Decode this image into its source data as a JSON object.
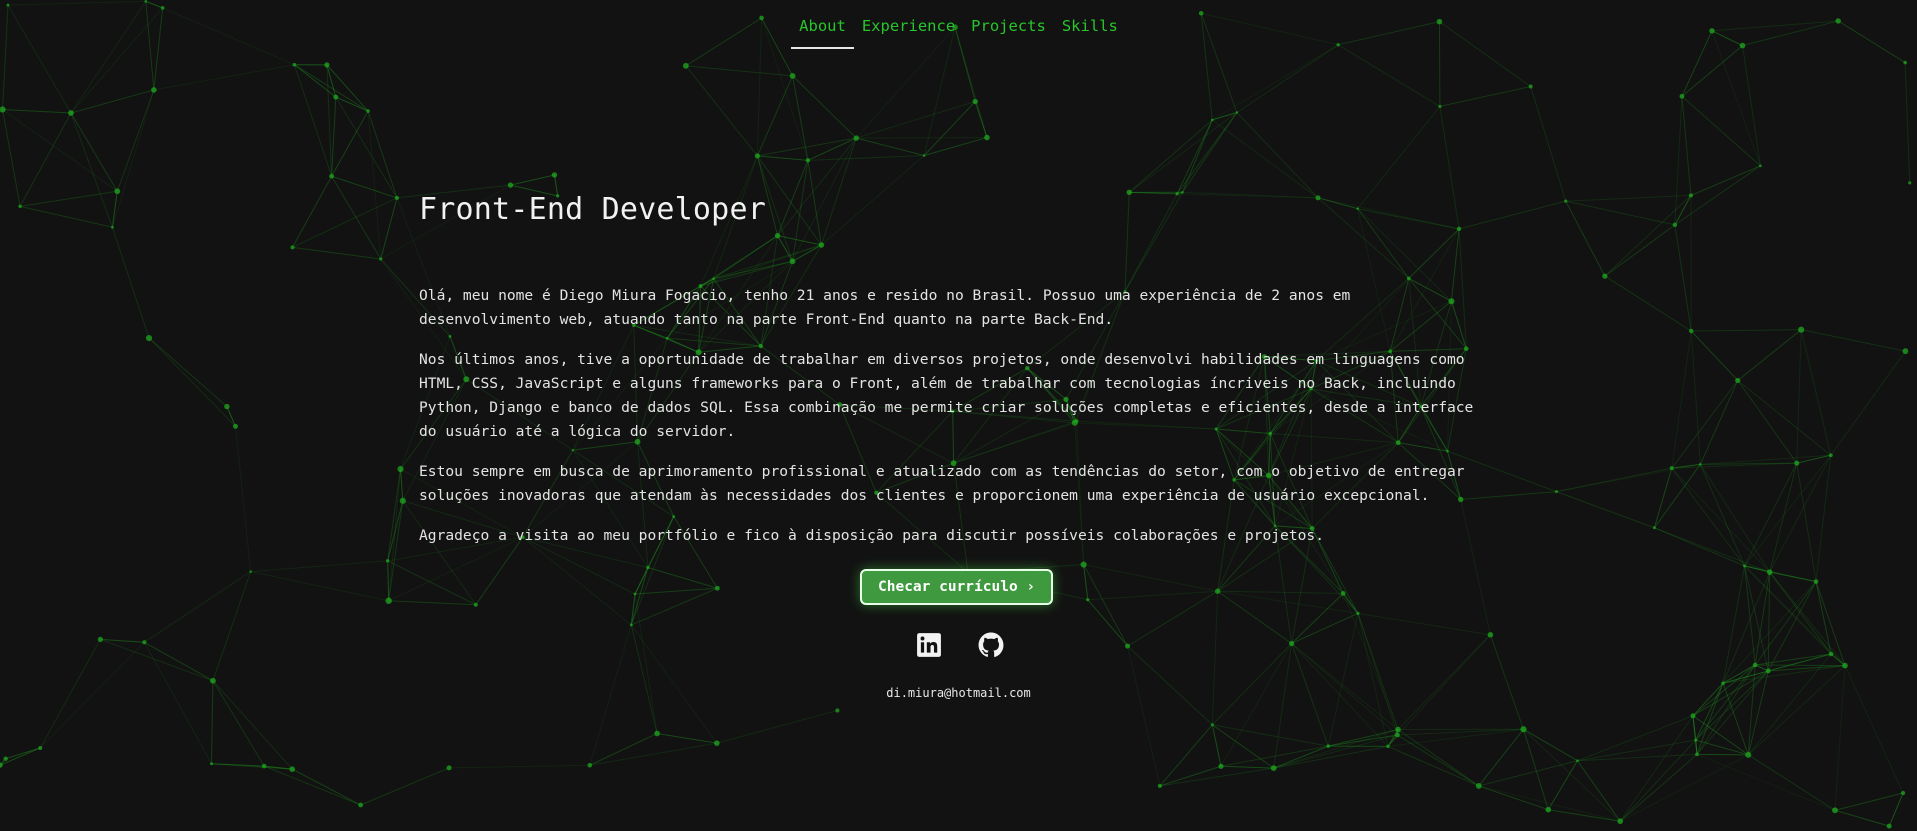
{
  "nav": {
    "items": [
      {
        "label": "About",
        "active": true
      },
      {
        "label": "Experience",
        "active": false
      },
      {
        "label": "Projects",
        "active": false
      },
      {
        "label": "Skills",
        "active": false
      }
    ]
  },
  "hero": {
    "title": "Front-End Developer",
    "paragraphs": [
      "Olá, meu nome é Diego Miura Fogacio, tenho 21 anos e resido no Brasil. Possuo uma experiência de 2 anos em\ndesenvolvimento web, atuando tanto na parte Front-End quanto na parte Back-End.",
      "Nos últimos anos, tive a oportunidade de trabalhar em diversos projetos, onde desenvolvi habilidades em linguagens como\nHTML, CSS, JavaScript e alguns frameworks para o Front, além de trabalhar com tecnologias íncriveis no Back, incluindo\nPython, Django e banco de dados SQL. Essa combinação me permite criar soluções completas e eficientes, desde a interface\ndo usuário até a lógica do servidor.",
      "Estou sempre em busca de aprimoramento profissional e atualizado com as tendências do setor, com o objetivo de entregar\nsoluções inovadoras que atendam às necessidades dos clientes e proporcionem uma experiência de usuário excepcional.",
      "Agradeço a visita ao meu portfólio e fico à disposição para discutir possíveis colaborações e projetos."
    ]
  },
  "cta": {
    "label": "Checar currículo ›"
  },
  "social": {
    "icons": [
      "linkedin-icon",
      "github-icon"
    ]
  },
  "contact": {
    "email": "di.miura@hotmail.com"
  },
  "theme": {
    "background": "#121212",
    "accent": "#28c52a",
    "button": "#3f9a3f"
  }
}
